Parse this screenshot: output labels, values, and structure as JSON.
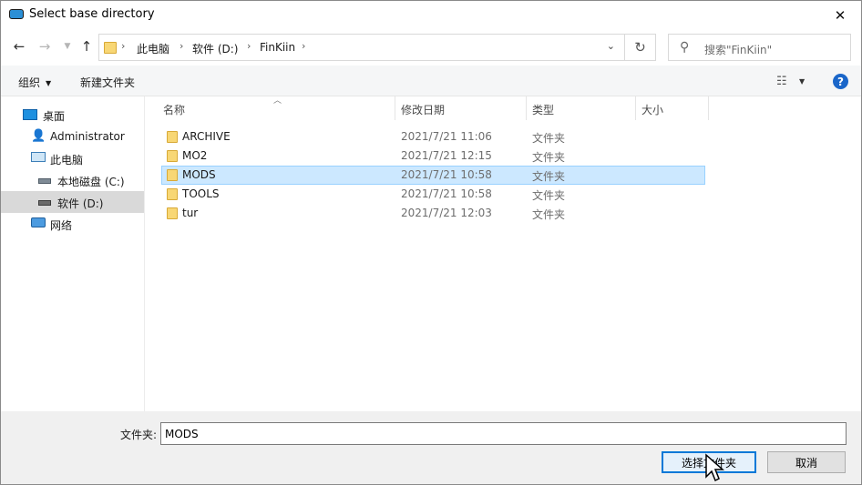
{
  "window": {
    "title": "Select base directory"
  },
  "address": {
    "segments": [
      "此电脑",
      "软件 (D:)",
      "FinKiin"
    ]
  },
  "search": {
    "placeholder": "搜索\"FinKiin\""
  },
  "toolbar": {
    "organize": "组织",
    "new_folder": "新建文件夹"
  },
  "sidebar": {
    "items": [
      {
        "label": "桌面",
        "icon": "desktop-icon"
      },
      {
        "label": "Administrator",
        "icon": "user-icon"
      },
      {
        "label": "此电脑",
        "icon": "computer-icon"
      },
      {
        "label": "本地磁盘 (C:)",
        "icon": "drive-icon"
      },
      {
        "label": "软件 (D:)",
        "icon": "drive-icon",
        "selected": true
      },
      {
        "label": "网络",
        "icon": "network-icon"
      }
    ]
  },
  "columns": {
    "name": "名称",
    "modified": "修改日期",
    "type": "类型",
    "size": "大小"
  },
  "files": [
    {
      "name": "ARCHIVE",
      "modified": "2021/7/21 11:06",
      "type": "文件夹"
    },
    {
      "name": "MO2",
      "modified": "2021/7/21 12:15",
      "type": "文件夹"
    },
    {
      "name": "MODS",
      "modified": "2021/7/21 10:58",
      "type": "文件夹",
      "selected": true
    },
    {
      "name": "TOOLS",
      "modified": "2021/7/21 10:58",
      "type": "文件夹"
    },
    {
      "name": "tur",
      "modified": "2021/7/21 12:03",
      "type": "文件夹"
    }
  ],
  "footer": {
    "folder_label": "文件夹:",
    "folder_value": "MODS",
    "select_button": "选择文件夹",
    "cancel_button": "取消"
  },
  "colors": {
    "accent": "#0078d7",
    "selection": "#cce8ff",
    "folder": "#f8d775"
  }
}
